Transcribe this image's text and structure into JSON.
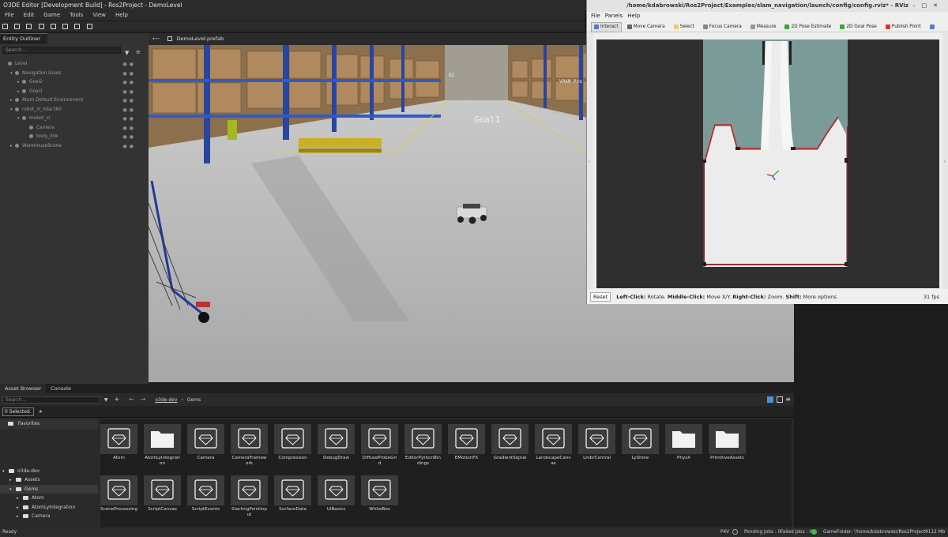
{
  "editor": {
    "title": "O3DE Editor [Development Build] - Ros2Project - DemoLevel",
    "menu": [
      "File",
      "Edit",
      "Game",
      "Tools",
      "View",
      "Help"
    ]
  },
  "outliner": {
    "tab": "Entity Outliner",
    "search_placeholder": "Search...",
    "entities": [
      {
        "label": "Level",
        "indent": 0,
        "expand": ""
      },
      {
        "label": "Navigation Goals",
        "indent": 1,
        "expand": "▾"
      },
      {
        "label": "Goal2",
        "indent": 2,
        "expand": "▸"
      },
      {
        "label": "Goal1",
        "indent": 2,
        "expand": "▸"
      },
      {
        "label": "Atom Default Environment",
        "indent": 1,
        "expand": "▸"
      },
      {
        "label": "robot_xl_lidar360",
        "indent": 1,
        "expand": "▾"
      },
      {
        "label": "mobot_xl",
        "indent": 2,
        "expand": "▾"
      },
      {
        "label": "Camera",
        "indent": 3,
        "expand": ""
      },
      {
        "label": "body_link",
        "indent": 3,
        "expand": ""
      },
      {
        "label": "WarehouseScene",
        "indent": 1,
        "expand": "▸"
      }
    ]
  },
  "viewport": {
    "tab": "DemoLevel.prefab",
    "goal_label": "Goal1"
  },
  "asset_browser": {
    "tabs": [
      "Asset Browser",
      "Console"
    ],
    "search_placeholder": "Search...",
    "breadcrumb_root": "o3de-dev",
    "breadcrumb_sep": "›",
    "breadcrumb_current": "Gems",
    "selected": "0 Selected.",
    "favorites": "Favorites",
    "tree": [
      {
        "label": "o3de-dev",
        "indent": 0,
        "expand": "▾"
      },
      {
        "label": "Assets",
        "indent": 1,
        "expand": "▸"
      },
      {
        "label": "Gems",
        "indent": 1,
        "expand": "▾"
      },
      {
        "label": "Atom",
        "indent": 2,
        "expand": "▸"
      },
      {
        "label": "AtomLyIntegration",
        "indent": 2,
        "expand": "▸"
      },
      {
        "label": "Camera",
        "indent": 2,
        "expand": "▸"
      }
    ],
    "gems": [
      {
        "label": "Atom",
        "kind": "gem"
      },
      {
        "label": "AtomLyIntegration",
        "kind": "folder"
      },
      {
        "label": "Camera",
        "kind": "gem"
      },
      {
        "label": "CameraFramework",
        "kind": "gem"
      },
      {
        "label": "Compression",
        "kind": "gem"
      },
      {
        "label": "DebugDraw",
        "kind": "gem"
      },
      {
        "label": "DiffuseProbeGrid",
        "kind": "gem"
      },
      {
        "label": "EditorPythonBindings",
        "kind": "gem"
      },
      {
        "label": "EMotionFX",
        "kind": "gem"
      },
      {
        "label": "GradientSignal",
        "kind": "gem"
      },
      {
        "label": "LandscapeCanvas",
        "kind": "gem"
      },
      {
        "label": "LmbrCentral",
        "kind": "gem"
      },
      {
        "label": "LyShine",
        "kind": "gem"
      },
      {
        "label": "PhysX",
        "kind": "folder"
      },
      {
        "label": "PrimitiveAssets",
        "kind": "folder"
      },
      {
        "label": "SceneProcessing",
        "kind": "gem"
      },
      {
        "label": "ScriptCanvas",
        "kind": "gem"
      },
      {
        "label": "ScriptEvents",
        "kind": "gem"
      },
      {
        "label": "StartingPointInput",
        "kind": "gem"
      },
      {
        "label": "SurfaceData",
        "kind": "gem"
      },
      {
        "label": "UiBasics",
        "kind": "gem"
      },
      {
        "label": "WhiteBox",
        "kind": "gem"
      }
    ]
  },
  "status": {
    "ready": "Ready",
    "p4v": "P4V",
    "pending": "Pending Jobs : 0",
    "failed": "Failed Jobs : 0",
    "gamefolder": "GameFolder: '/home/kdabrowski/Ros2Project'",
    "memory": "4112 Mb"
  },
  "rviz": {
    "title": "/home/kdabrowski/Ros2Project/Examples/slam_navigation/launch/config/config.rviz* - RViz",
    "menu": [
      "File",
      "Panels",
      "Help"
    ],
    "tools": [
      {
        "label": "Interact",
        "color": "#4a7fd0",
        "active": true
      },
      {
        "label": "Move Camera",
        "color": "#666666",
        "active": false
      },
      {
        "label": "Select",
        "color": "#e8d060",
        "active": false
      },
      {
        "label": "Focus Camera",
        "color": "#888888",
        "active": false
      },
      {
        "label": "Measure",
        "color": "#999999",
        "active": false
      },
      {
        "label": "2D Pose Estimate",
        "color": "#36a836",
        "active": false
      },
      {
        "label": "2D Goal Pose",
        "color": "#36a836",
        "active": false
      },
      {
        "label": "Publish Point",
        "color": "#d03a2a",
        "active": false
      },
      {
        "label": "",
        "color": "#4a7fd0",
        "active": false
      }
    ],
    "reset": "Reset",
    "hint": [
      {
        "bold": "Left-Click:",
        "text": " Rotate. "
      },
      {
        "bold": "Middle-Click:",
        "text": " Move X/Y. "
      },
      {
        "bold": "Right-Click:",
        "text": " Zoom. "
      },
      {
        "bold": "Shift:",
        "text": " More options."
      }
    ],
    "fps": "31 fps"
  }
}
